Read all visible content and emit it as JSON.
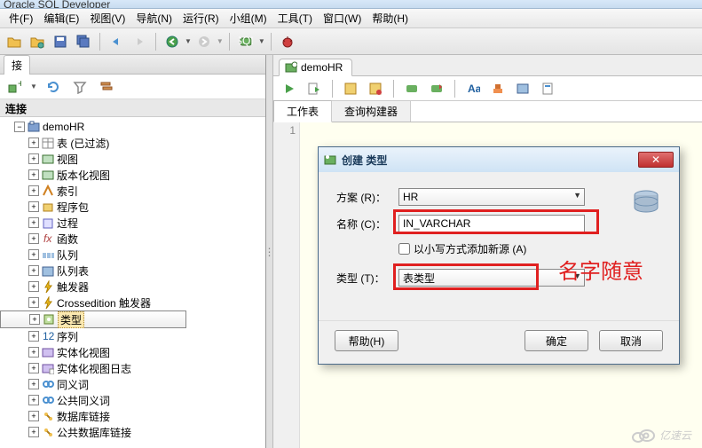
{
  "window_title": "Oracle SQL Developer",
  "menus": [
    "件(F)",
    "编辑(E)",
    "视图(V)",
    "导航(N)",
    "运行(R)",
    "小组(M)",
    "工具(T)",
    "窗口(W)",
    "帮助(H)"
  ],
  "left": {
    "tab": "接",
    "header": "连接",
    "root": "demoHR",
    "items": [
      {
        "label": "表 (已过滤)",
        "icon": "table"
      },
      {
        "label": "视图",
        "icon": "view"
      },
      {
        "label": "版本化视图",
        "icon": "view"
      },
      {
        "label": "索引",
        "icon": "index"
      },
      {
        "label": "程序包",
        "icon": "package"
      },
      {
        "label": "过程",
        "icon": "proc"
      },
      {
        "label": "函数",
        "icon": "func"
      },
      {
        "label": "队列",
        "icon": "queue"
      },
      {
        "label": "队列表",
        "icon": "queuetbl"
      },
      {
        "label": "触发器",
        "icon": "trigger"
      },
      {
        "label": "Crossedition 触发器",
        "icon": "trigger"
      },
      {
        "label": "类型",
        "icon": "type",
        "selected": true
      },
      {
        "label": "序列",
        "icon": "seq"
      },
      {
        "label": "实体化视图",
        "icon": "mview"
      },
      {
        "label": "实体化视图日志",
        "icon": "mviewlog"
      },
      {
        "label": "同义词",
        "icon": "syn"
      },
      {
        "label": "公共同义词",
        "icon": "syn"
      },
      {
        "label": "数据库链接",
        "icon": "dblink"
      },
      {
        "label": "公共数据库链接",
        "icon": "dblink"
      }
    ]
  },
  "editor": {
    "tab": "demoHR",
    "subtabs": [
      "工作表",
      "查询构建器"
    ],
    "gutter": "1"
  },
  "dialog": {
    "title": "创建 类型",
    "labels": {
      "schema": "方案 (R)：",
      "name": "名称 (C)：",
      "lowercase": "以小写方式添加新源 (A)",
      "type": "类型 (T)："
    },
    "values": {
      "schema": "HR",
      "name": "IN_VARCHAR",
      "type": "表类型"
    },
    "buttons": {
      "help": "帮助(H)",
      "ok": "确定",
      "cancel": "取消"
    }
  },
  "annotation": "名字随意",
  "watermark": "亿速云"
}
